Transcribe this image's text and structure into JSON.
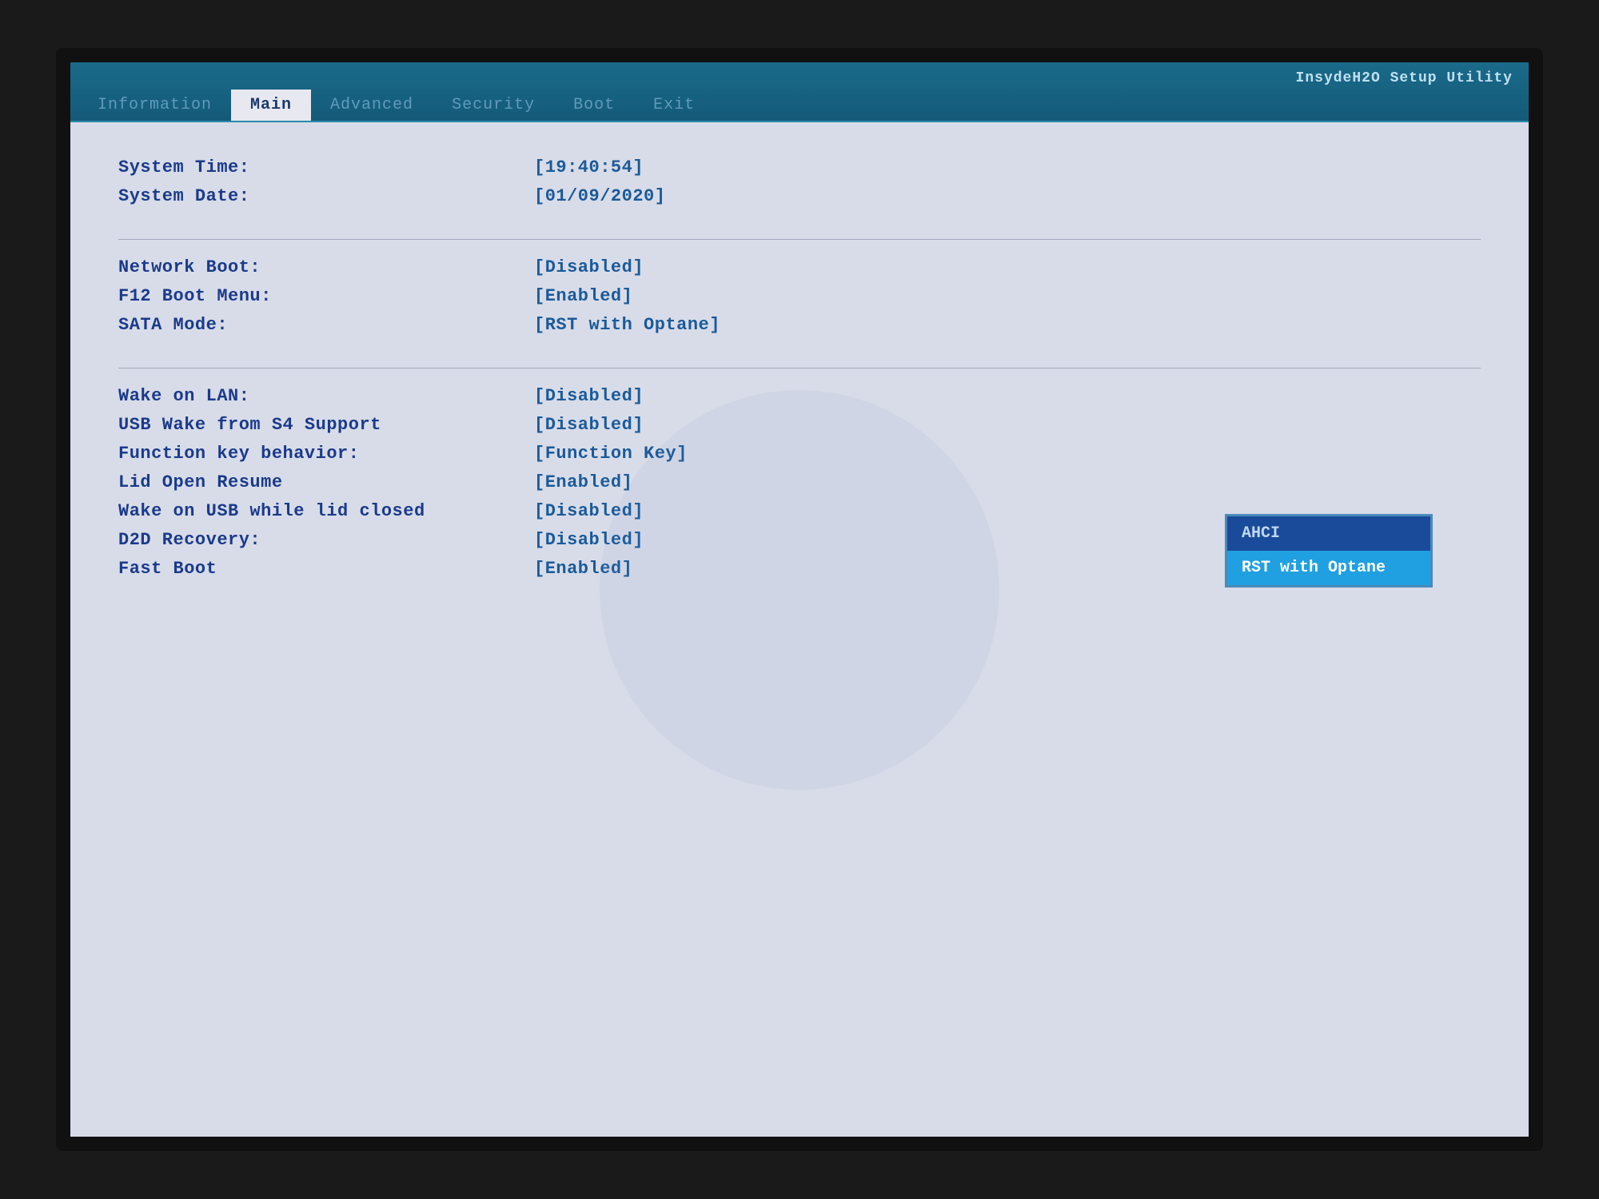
{
  "bios": {
    "title": "InsydeH2O Setup Utility",
    "nav": [
      {
        "label": "Information",
        "state": "inactive"
      },
      {
        "label": "Main",
        "state": "active"
      },
      {
        "label": "Advanced",
        "state": "inactive"
      },
      {
        "label": "Security",
        "state": "inactive"
      },
      {
        "label": "Boot",
        "state": "inactive"
      },
      {
        "label": "Exit",
        "state": "inactive"
      }
    ],
    "settings": {
      "group1": [
        {
          "label": "System Time:",
          "value": "[19:40:54]"
        },
        {
          "label": "System Date:",
          "value": "[01/09/2020]"
        }
      ],
      "group2": [
        {
          "label": "Network Boot:",
          "value": "[Disabled]"
        },
        {
          "label": "F12 Boot Menu:",
          "value": "[Enabled]"
        },
        {
          "label": "SATA Mode:",
          "value": "[RST with Optane]"
        }
      ],
      "group3": [
        {
          "label": "Wake on LAN:",
          "value": "[Disabled]"
        },
        {
          "label": "USB Wake from S4 Support",
          "value": "[Disabled]"
        },
        {
          "label": "Function key behavior:",
          "value": "[Function Key]"
        },
        {
          "label": "Lid Open Resume",
          "value": "[Enabled]"
        },
        {
          "label": "Wake on USB while lid closed",
          "value": "[Disabled]"
        },
        {
          "label": "D2D Recovery:",
          "value": "[Disabled]"
        },
        {
          "label": "Fast Boot",
          "value": "[Enabled]"
        }
      ]
    },
    "dropdown": {
      "options": [
        {
          "label": "AHCI",
          "selected": false
        },
        {
          "label": "RST with Optane",
          "selected": true
        }
      ]
    }
  }
}
